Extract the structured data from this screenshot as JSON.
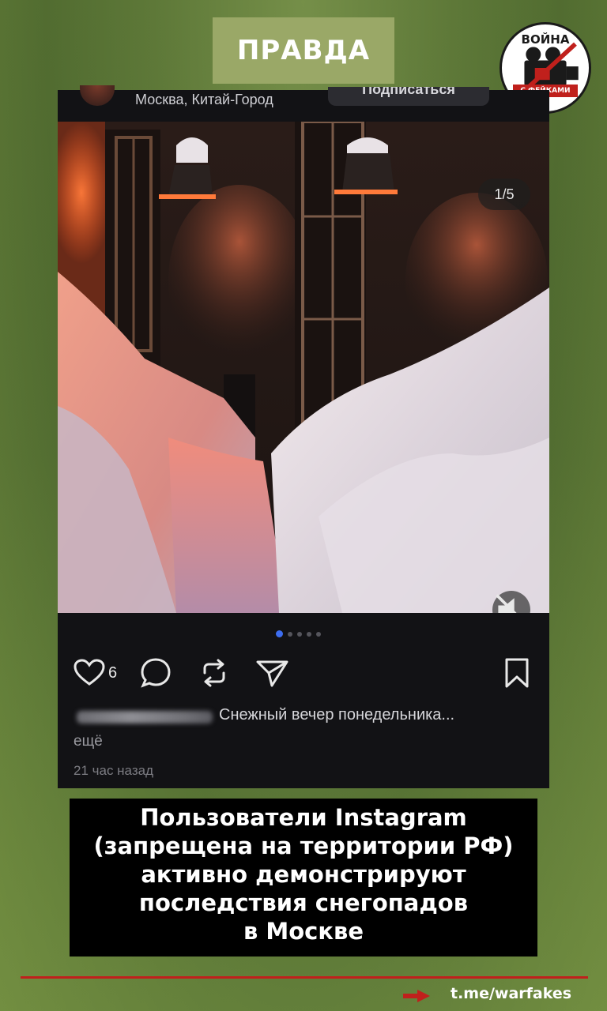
{
  "top_badge": {
    "label": "ПРАВДА"
  },
  "logo": {
    "top_text": "ВОЙНА",
    "bottom_text": "С ФЕЙКАМИ",
    "icon": "film-camera-crossed-icon"
  },
  "post": {
    "location": "Москва, Китай-Город",
    "subscribe_label": "Подписаться",
    "image_counter": "1/5",
    "carousel": {
      "total": 5,
      "active_index": 0
    },
    "like_count": "6",
    "caption_text": "Снежный вечер понедельника...",
    "more_label": "ещё",
    "timestamp": "21 час назад",
    "icons": [
      "heart-icon",
      "comment-icon",
      "repost-icon",
      "send-icon",
      "bookmark-icon",
      "mute-icon"
    ]
  },
  "headline": {
    "lines": [
      "Пользователи Instagram",
      "(запрещена на территории РФ)",
      "активно демонстрируют",
      "последствия снегопадов",
      "в Москве"
    ]
  },
  "footer": {
    "link": "t.me/warfakes",
    "accent": "#c0201c"
  }
}
